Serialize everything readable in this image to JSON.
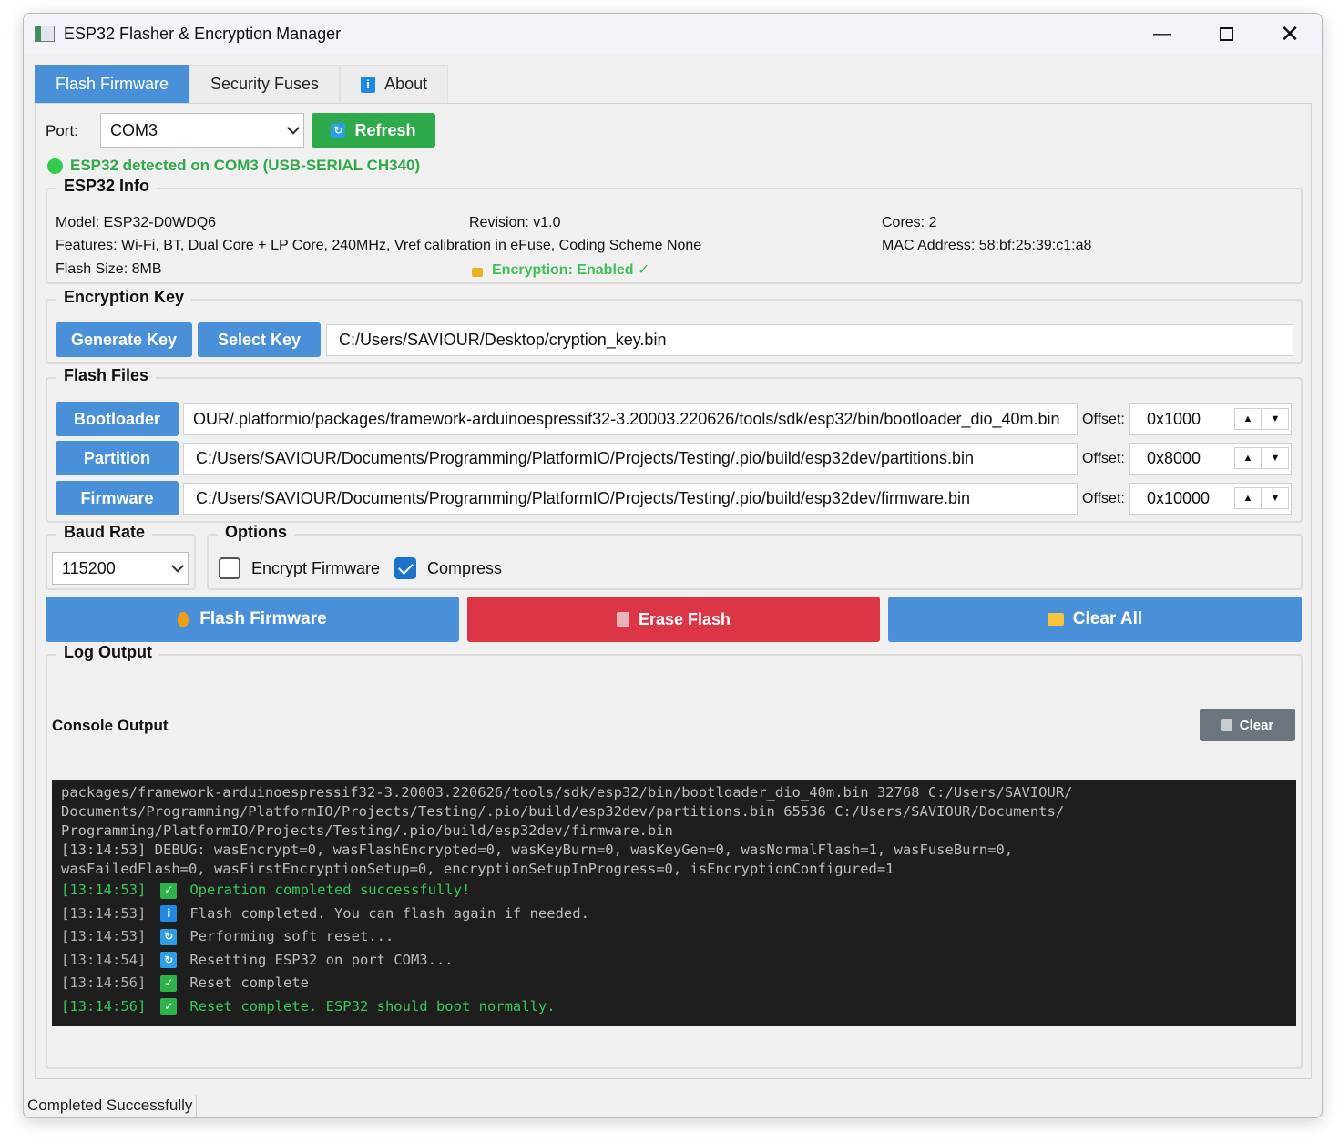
{
  "window": {
    "title": "ESP32 Flasher & Encryption Manager"
  },
  "tabs": [
    {
      "label": "Flash Firmware"
    },
    {
      "label": "Security Fuses"
    },
    {
      "label": "About"
    }
  ],
  "port": {
    "label": "Port:",
    "value": "COM3",
    "refresh_label": "Refresh"
  },
  "detection": {
    "text": "ESP32 detected on COM3 (USB-SERIAL CH340)",
    "color": "#2eaa4a"
  },
  "esp32_info": {
    "title": "ESP32 Info",
    "model": "Model: ESP32-D0WDQ6",
    "revision": "Revision: v1.0",
    "cores": "Cores: 2",
    "features": "Features: Wi-Fi, BT, Dual Core + LP Core, 240MHz, Vref calibration in eFuse, Coding Scheme None",
    "mac": "MAC Address: 58:bf:25:39:c1:a8",
    "flash_size": "Flash Size: 8MB",
    "encryption": "Encryption: Enabled ✓"
  },
  "encryption_key": {
    "title": "Encryption Key",
    "generate_label": "Generate Key",
    "select_label": "Select Key",
    "path": "C:/Users/SAVIOUR/Desktop/cryption_key.bin"
  },
  "flash_files": {
    "title": "Flash Files",
    "offset_label": "Offset:",
    "rows": [
      {
        "button": "Bootloader",
        "path": "OUR/.platformio/packages/framework-arduinoespressif32-3.20003.220626/tools/sdk/esp32/bin/bootloader_dio_40m.bin",
        "offset": "0x1000"
      },
      {
        "button": "Partition",
        "path": "C:/Users/SAVIOUR/Documents/Programming/PlatformIO/Projects/Testing/.pio/build/esp32dev/partitions.bin",
        "offset": "0x8000"
      },
      {
        "button": "Firmware",
        "path": "C:/Users/SAVIOUR/Documents/Programming/PlatformIO/Projects/Testing/.pio/build/esp32dev/firmware.bin",
        "offset": "0x10000"
      }
    ]
  },
  "baud": {
    "title": "Baud Rate",
    "value": "115200"
  },
  "options": {
    "title": "Options",
    "encrypt_label": "Encrypt Firmware",
    "encrypt_checked": false,
    "compress_label": "Compress",
    "compress_checked": true
  },
  "actions": {
    "flash_label": "Flash Firmware",
    "erase_label": "Erase Flash",
    "clear_all_label": "Clear All"
  },
  "log": {
    "title": "Log Output",
    "console_label": "Console Output",
    "clear_label": "Clear",
    "wrapped": [
      "packages/framework-arduinoespressif32-3.20003.220626/tools/sdk/esp32/bin/bootloader_dio_40m.bin 32768 C:/Users/SAVIOUR/",
      "Documents/Programming/PlatformIO/Projects/Testing/.pio/build/esp32dev/partitions.bin 65536 C:/Users/SAVIOUR/Documents/",
      "Programming/PlatformIO/Projects/Testing/.pio/build/esp32dev/firmware.bin",
      "[13:14:53] DEBUG: wasEncrypt=0, wasFlashEncrypted=0, wasKeyBurn=0, wasKeyGen=0, wasNormalFlash=1, wasFuseBurn=0,",
      "wasFailedFlash=0, wasFirstEncryptionSetup=0, encryptionSetupInProgress=0, isEncryptionConfigured=1"
    ],
    "entries": [
      {
        "time": "[13:14:53]",
        "icon": "check-icon",
        "text": "Operation completed successfully!",
        "highlight": true
      },
      {
        "time": "[13:14:53]",
        "icon": "info-icon",
        "text": "Flash completed. You can flash again if needed.",
        "highlight": false
      },
      {
        "time": "[13:14:53]",
        "icon": "refresh-icon",
        "text": "Performing soft reset...",
        "highlight": false
      },
      {
        "time": "[13:14:54]",
        "icon": "refresh-icon",
        "text": "Resetting ESP32 on port COM3...",
        "highlight": false
      },
      {
        "time": "[13:14:56]",
        "icon": "check-icon",
        "text": "Reset complete",
        "highlight": false
      },
      {
        "time": "[13:14:56]",
        "icon": "check-icon",
        "text": "Reset complete. ESP32 should boot normally.",
        "highlight": true
      }
    ]
  },
  "status": {
    "text": "Completed Successfully"
  }
}
